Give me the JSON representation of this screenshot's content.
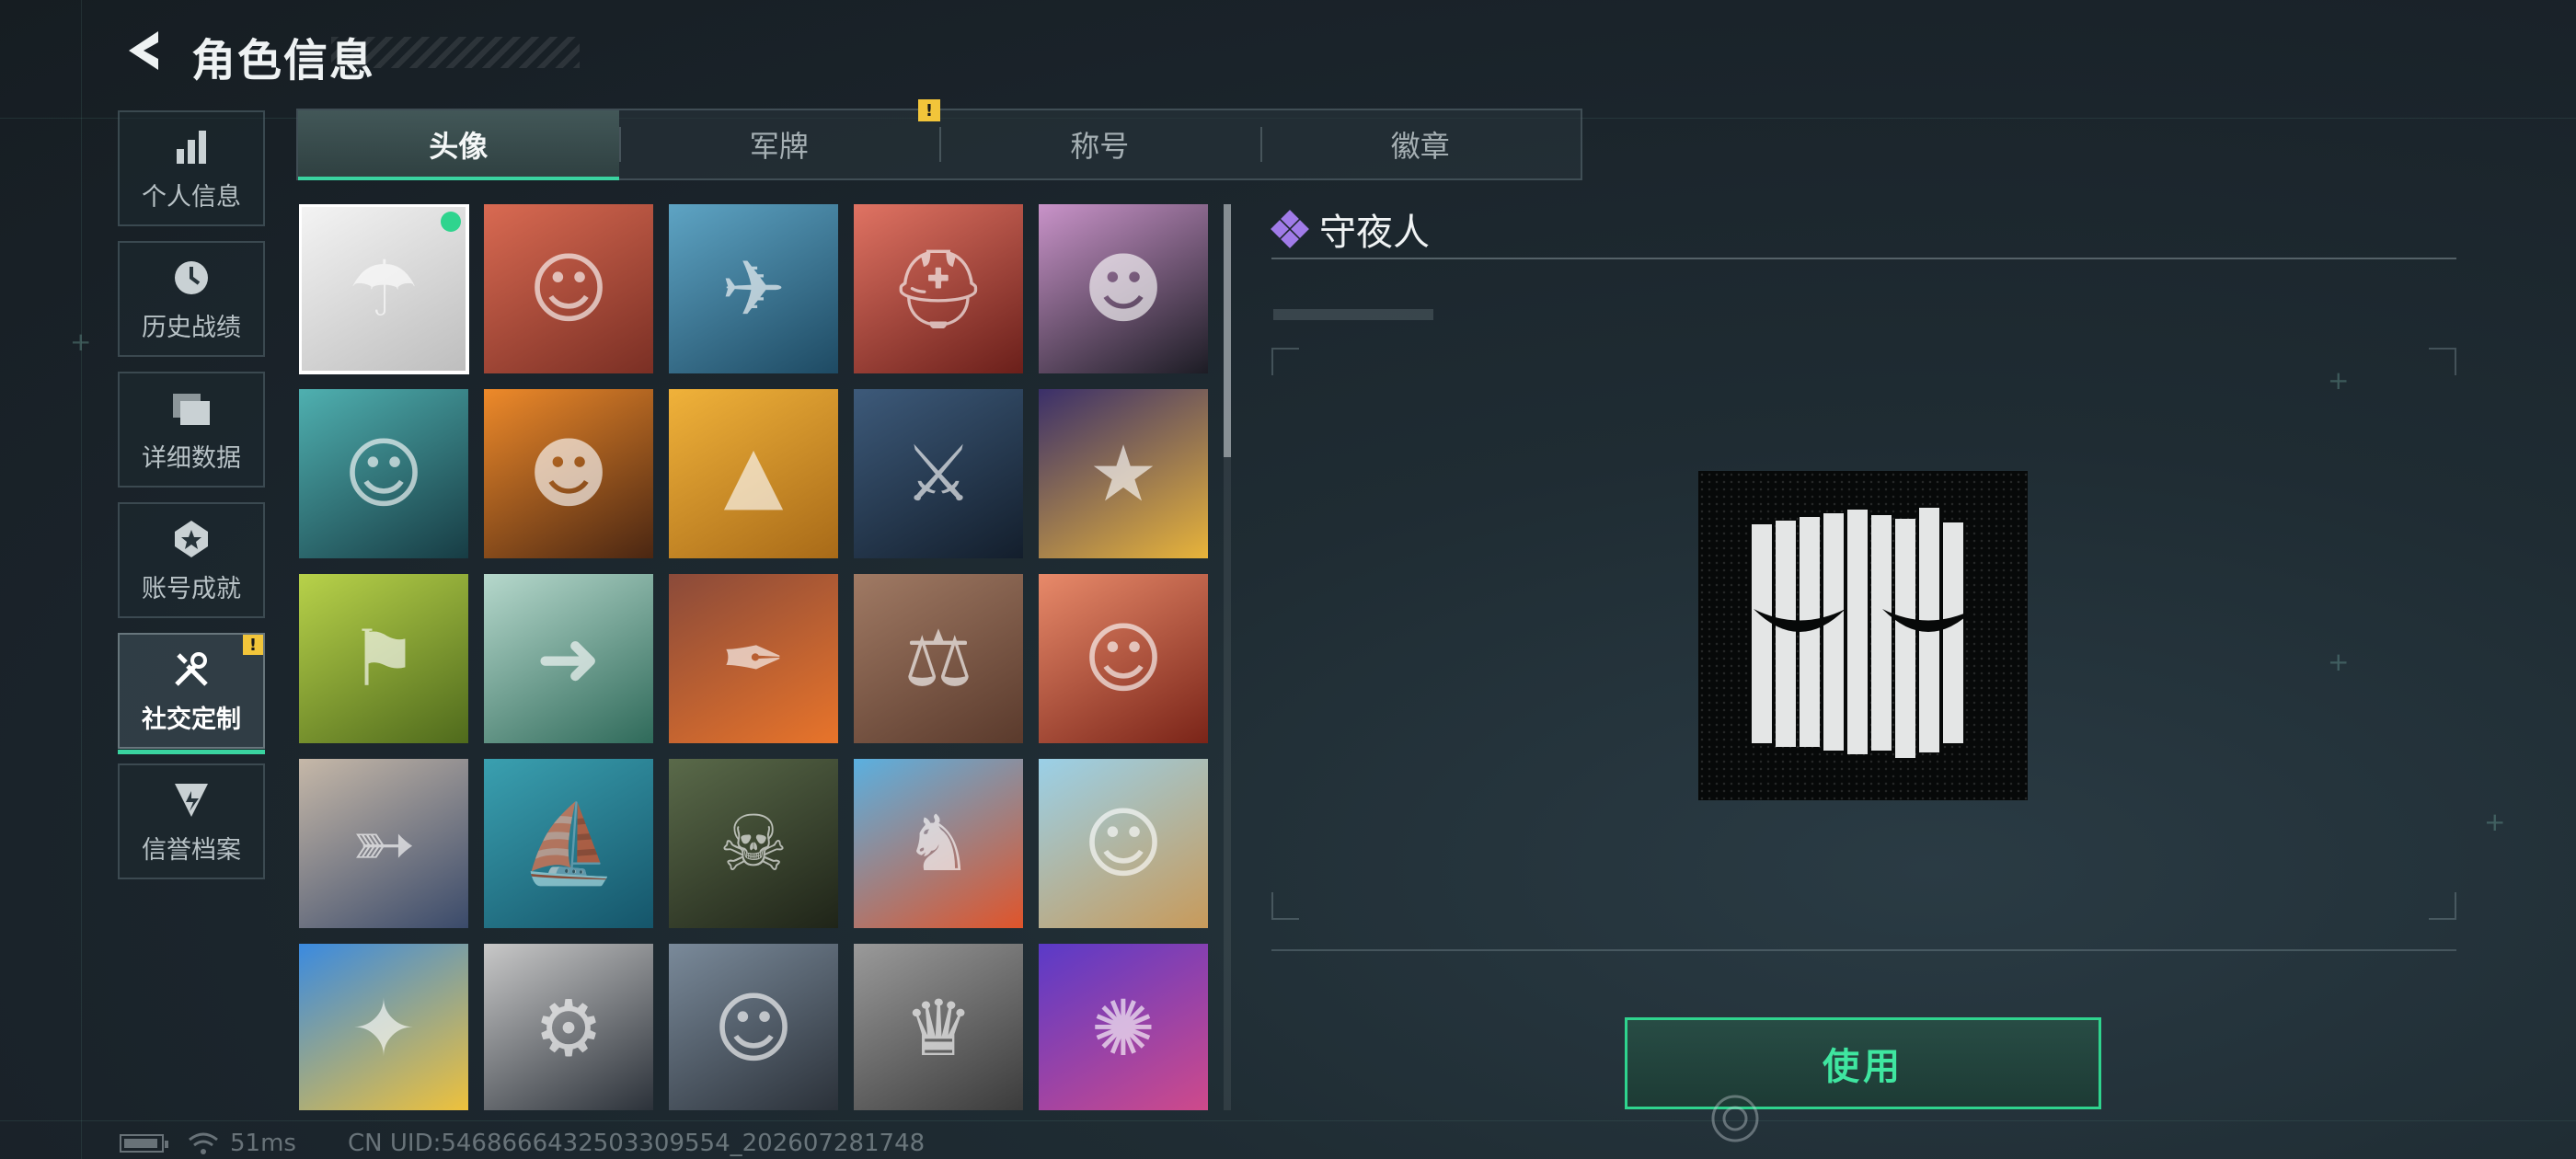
{
  "header": {
    "title": "角色信息"
  },
  "sidebar": {
    "items": [
      {
        "label": "个人信息",
        "icon": "bar-chart-icon"
      },
      {
        "label": "历史战绩",
        "icon": "history-clock-icon"
      },
      {
        "label": "详细数据",
        "icon": "folder-icon"
      },
      {
        "label": "账号成就",
        "icon": "achievement-star-icon"
      },
      {
        "label": "社交定制",
        "icon": "tools-icon",
        "active": true,
        "alert": "!"
      },
      {
        "label": "信誉档案",
        "icon": "credit-shield-icon"
      }
    ]
  },
  "tabs": [
    {
      "label": "头像",
      "active": true
    },
    {
      "label": "军牌"
    },
    {
      "label": "称号"
    },
    {
      "label": "徽章"
    }
  ],
  "tab_alert": "!",
  "avatars": [
    {
      "icon": "☂",
      "colors": [
        "#f4f4f4",
        "#bdbdbd"
      ],
      "selected": true,
      "equipped": true
    },
    {
      "icon": "☺",
      "colors": [
        "#d96a52",
        "#7a2f24"
      ]
    },
    {
      "icon": "✈",
      "colors": [
        "#5ea4c4",
        "#1e4a63"
      ]
    },
    {
      "icon": "⛑",
      "colors": [
        "#e07363",
        "#6a1f1a"
      ]
    },
    {
      "icon": "☻",
      "colors": [
        "#c993c9",
        "#1c1c24"
      ]
    },
    {
      "icon": "☺",
      "colors": [
        "#4fb0b0",
        "#173c44"
      ]
    },
    {
      "icon": "☻",
      "colors": [
        "#ee8a2a",
        "#4a2612"
      ]
    },
    {
      "icon": "▲",
      "colors": [
        "#f0b23a",
        "#a86a18"
      ]
    },
    {
      "icon": "⚔",
      "colors": [
        "#3d5a7a",
        "#131e2c"
      ]
    },
    {
      "icon": "★",
      "colors": [
        "#3a2f6a",
        "#e8b43a"
      ]
    },
    {
      "icon": "⚑",
      "colors": [
        "#b8d24a",
        "#4f6a1c"
      ]
    },
    {
      "icon": "➜",
      "colors": [
        "#b6d8cc",
        "#2f6a5a"
      ]
    },
    {
      "icon": "✒",
      "colors": [
        "#8a4a3a",
        "#e8742a"
      ]
    },
    {
      "icon": "⚖",
      "colors": [
        "#a07a64",
        "#5a3a2c"
      ]
    },
    {
      "icon": "☺",
      "colors": [
        "#e88a6a",
        "#7a2418"
      ]
    },
    {
      "icon": "➳",
      "colors": [
        "#c6b8a8",
        "#3a4a6a"
      ]
    },
    {
      "icon": "⛵",
      "colors": [
        "#3aa0b0",
        "#15556a"
      ]
    },
    {
      "icon": "☠",
      "colors": [
        "#5a6a4a",
        "#1f2418"
      ]
    },
    {
      "icon": "♞",
      "colors": [
        "#5ab0e0",
        "#e0542a"
      ]
    },
    {
      "icon": "☺",
      "colors": [
        "#9ad0e8",
        "#c89a5a"
      ]
    },
    {
      "icon": "✦",
      "colors": [
        "#3a8ae0",
        "#f0c23a"
      ]
    },
    {
      "icon": "⚙",
      "colors": [
        "#c8c8c8",
        "#2a3038"
      ]
    },
    {
      "icon": "☺",
      "colors": [
        "#7a8a9a",
        "#2a3038"
      ]
    },
    {
      "icon": "♛",
      "colors": [
        "#9a9a9a",
        "#3a3a3a"
      ]
    },
    {
      "icon": "✺",
      "colors": [
        "#5a3ac8",
        "#d04a8a"
      ]
    }
  ],
  "detail": {
    "title": "守夜人",
    "title_icon": "purple-diamond-icon"
  },
  "use_button": {
    "label": "使用"
  },
  "status": {
    "ping": "51ms",
    "uid": "CN UID:5468666432503309554_202607281748"
  },
  "colors": {
    "accent": "#3ad3a0",
    "alert": "#f2c53a",
    "purple": "#a07be8"
  }
}
